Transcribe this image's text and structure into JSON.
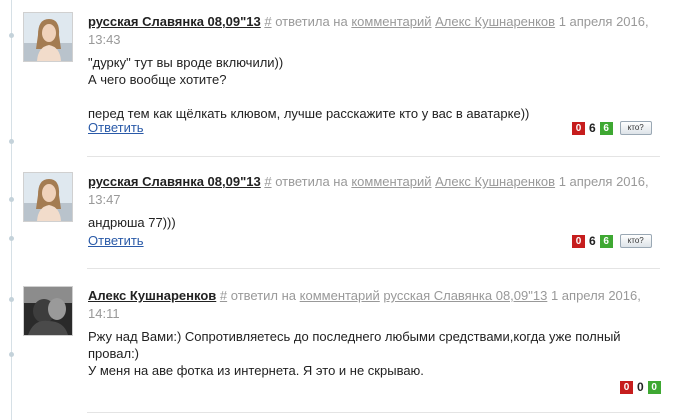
{
  "colors": {
    "reply_link": "#2a5aa8",
    "minus": "#c61d1d",
    "plus": "#3ea832",
    "meta": "#999999"
  },
  "comments": [
    {
      "author": "русская Славянка 08,09\"13",
      "hash": "#",
      "action": "ответила на",
      "comment_link": "комментарий",
      "target": "Алекс Кушнаренков",
      "date_line1": "1 апреля 2016,",
      "date_line2": "13:43",
      "lines": [
        "\"дурку\" тут вы вроде включили))",
        "А чего вообще хотите?",
        "",
        "перед тем как щёлкать клювом, лучше расскажите кто у вас в аватарке))"
      ],
      "reply": "Ответить",
      "minus": "0",
      "score": "6",
      "plus": "6",
      "who": "кто?"
    },
    {
      "author": "русская Славянка 08,09\"13",
      "hash": "#",
      "action": "ответила на",
      "comment_link": "комментарий",
      "target": "Алекс Кушнаренков",
      "date_line1": "1 апреля 2016,",
      "date_line2": "13:47",
      "lines": [
        "андрюша 77)))"
      ],
      "reply": "Ответить",
      "minus": "0",
      "score": "6",
      "plus": "6",
      "who": "кто?"
    },
    {
      "author": "Алекс Кушнаренков",
      "hash": "#",
      "action": "ответил на",
      "comment_link": "комментарий",
      "target": "русская Славянка 08,09\"13",
      "date_line1": "1 апреля 2016,",
      "date_line2": "14:11",
      "lines": [
        "Ржу над Вами:) Сопротивляетесь до последнего любыми средствами,когда уже полный",
        "провал:)",
        "У меня на аве фотка из интернета. Я это и не скрываю."
      ],
      "minus": "0",
      "score": "0",
      "plus": "0"
    }
  ]
}
